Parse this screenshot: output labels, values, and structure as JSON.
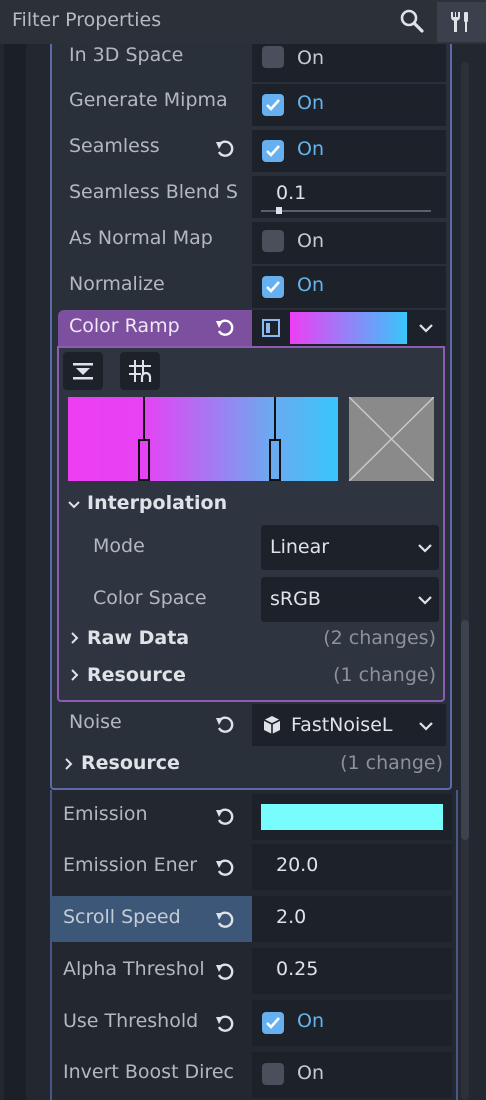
{
  "header": {
    "filter_placeholder": "Filter Properties",
    "search_icon": "search-icon",
    "tools_icon": "tools-icon"
  },
  "properties_top": [
    {
      "label": "In 3D Space",
      "checked": false,
      "value": "On"
    },
    {
      "label": "Generate Mipma",
      "checked": true,
      "value": "On"
    },
    {
      "label": "Seamless",
      "checked": true,
      "value": "On",
      "revert": true
    },
    {
      "label": "Seamless Blend S",
      "value": "0.1",
      "slider_fraction": 0.1
    },
    {
      "label": "As Normal Map",
      "checked": false,
      "value": "On"
    },
    {
      "label": "Normalize",
      "checked": true,
      "value": "On"
    }
  ],
  "color_ramp": {
    "label": "Color Ramp",
    "gradient_colors": [
      "#ee3ef4",
      "#38c6fb"
    ],
    "interpolation": {
      "title": "Interpolation",
      "mode_label": "Mode",
      "mode_value": "Linear",
      "color_space_label": "Color Space",
      "color_space_value": "sRGB"
    },
    "raw_data": {
      "title": "Raw Data",
      "changes": "(2 changes)"
    },
    "resource": {
      "title": "Resource",
      "changes": "(1 change)"
    }
  },
  "noise": {
    "label": "Noise",
    "value": "FastNoiseL",
    "resource_title": "Resource",
    "resource_changes": "(1 change)"
  },
  "properties_bottom": {
    "emission_label": "Emission",
    "emission_color": "#78fdfd",
    "emission_energy_label": "Emission Ener",
    "emission_energy_value": "20.0",
    "scroll_speed_label": "Scroll Speed",
    "scroll_speed_value": "2.0",
    "alpha_threshold_label": "Alpha Threshol",
    "alpha_threshold_value": "0.25",
    "use_threshold_label": "Use Threshold",
    "use_threshold_value": "On",
    "invert_boost_label": "Invert Boost Direc",
    "invert_boost_value": "On"
  }
}
